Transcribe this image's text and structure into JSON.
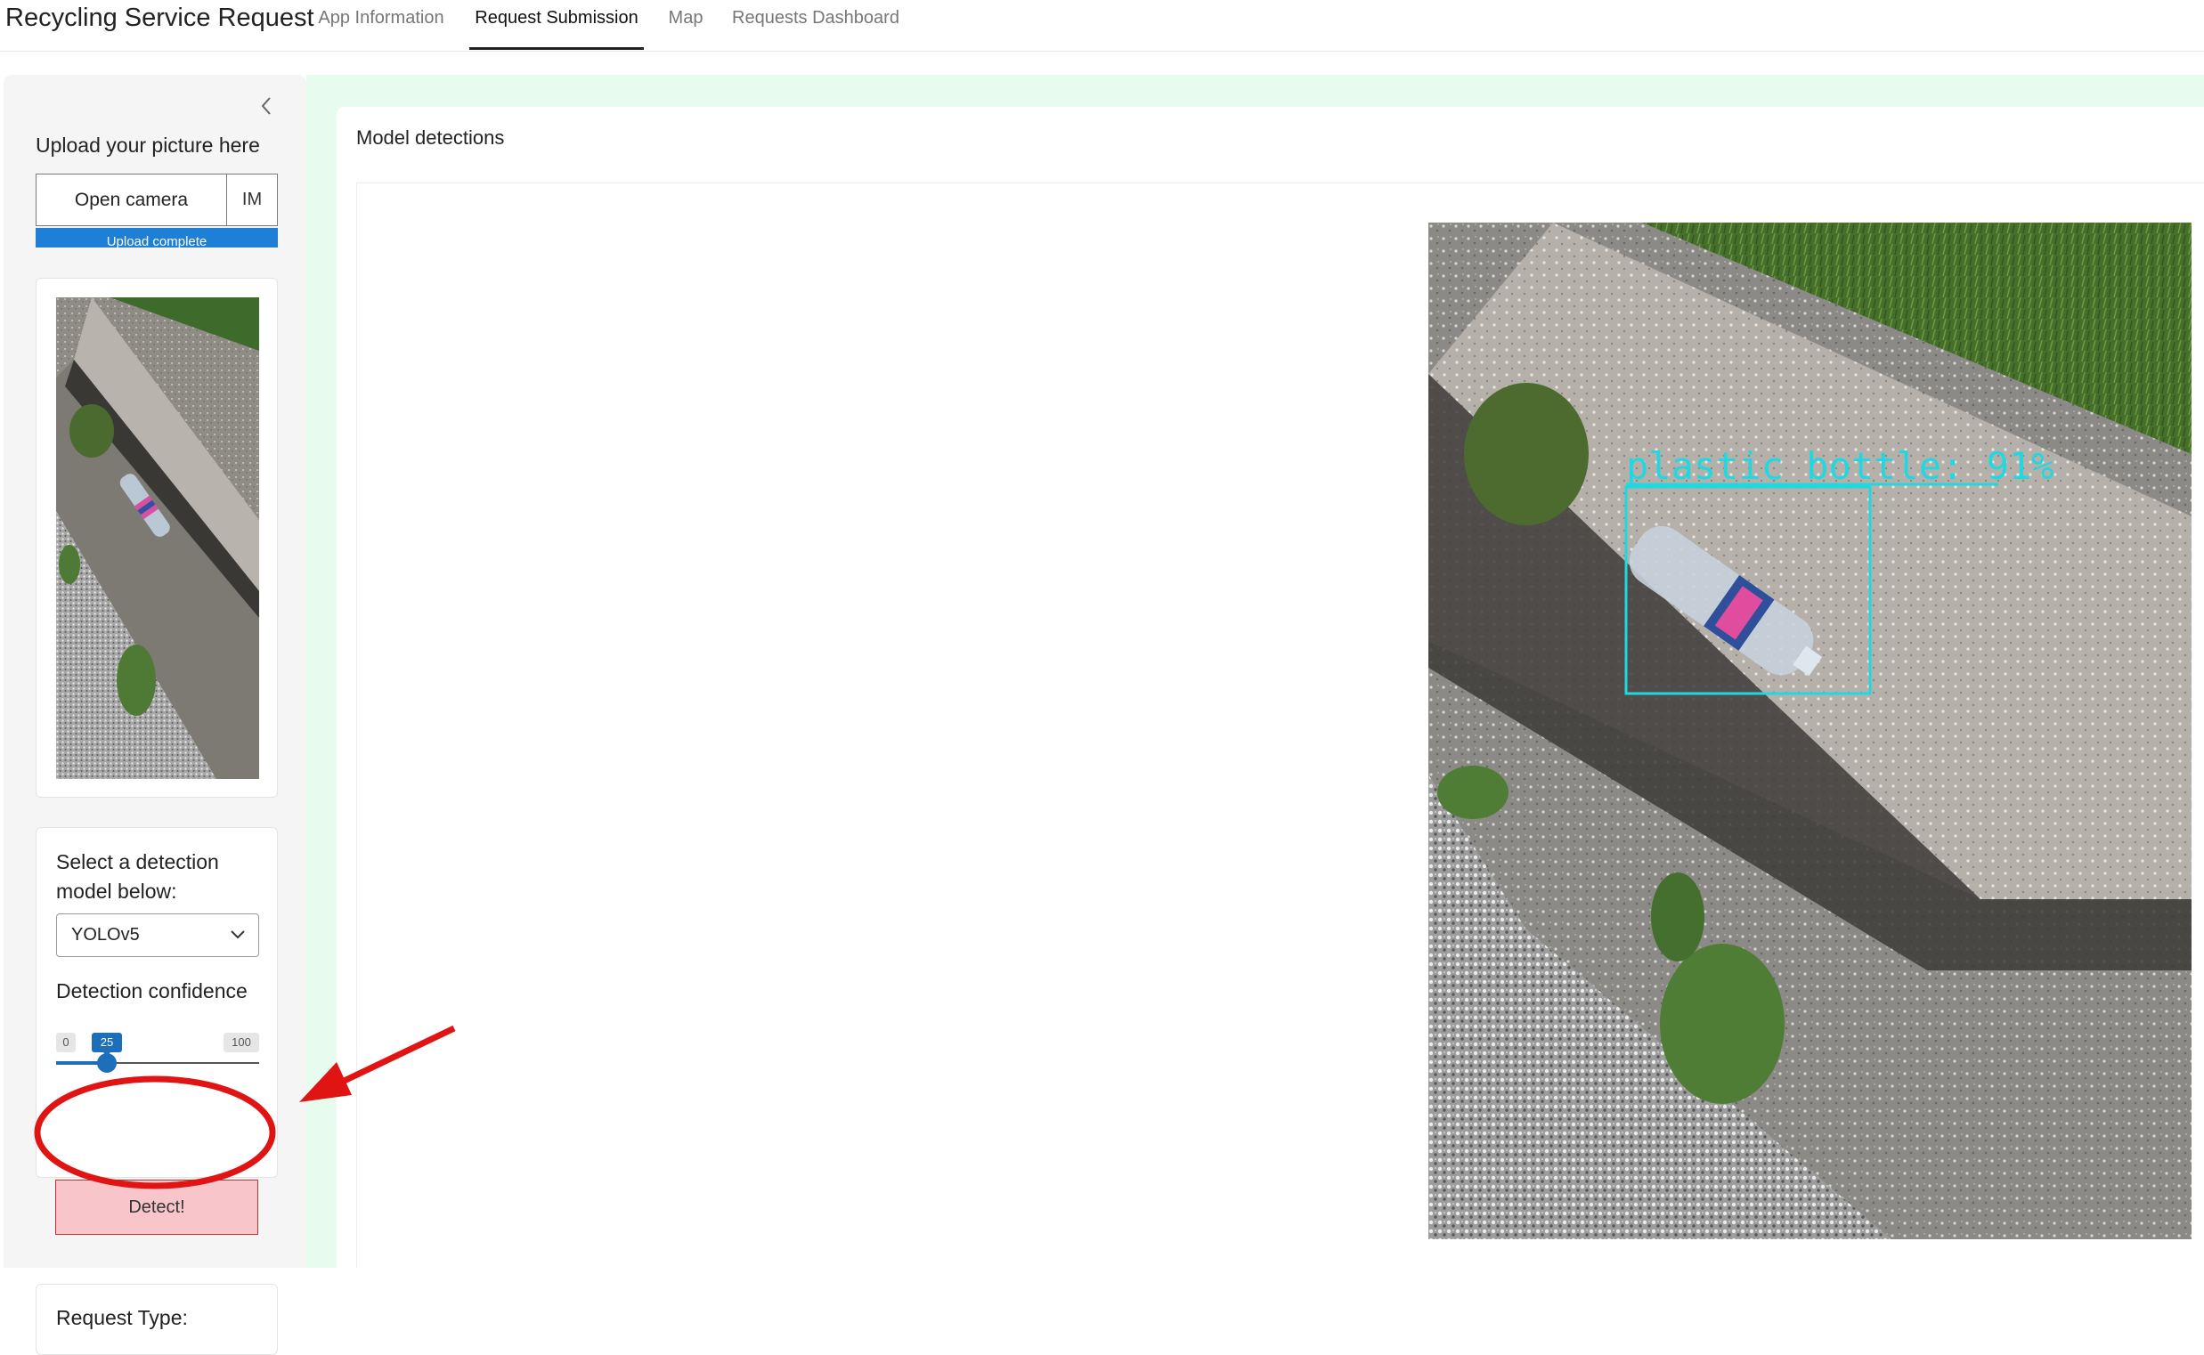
{
  "header": {
    "app_title": "Recycling Service Request",
    "tabs": [
      {
        "label": "App Information",
        "active": false
      },
      {
        "label": "Request Submission",
        "active": true
      },
      {
        "label": "Map",
        "active": false
      },
      {
        "label": "Requests Dashboard",
        "active": false
      }
    ]
  },
  "sidebar": {
    "collapse_icon": "chevron-left-icon",
    "upload_heading": "Upload your picture here",
    "open_camera_label": "Open camera",
    "file_name": "IM",
    "upload_status": "Upload complete",
    "upload_progress": 1.0,
    "model_label": "Select a detection model below:",
    "model_value": "YOLOv5",
    "confidence_label": "Detection confidence",
    "confidence_min": "0",
    "confidence_value": "25",
    "confidence_max": "100",
    "confidence_fraction": 0.25,
    "detect_label": "Detect!",
    "request_type_label": "Request Type:"
  },
  "main": {
    "title": "Model detections",
    "detection_label": "plastic_bottle: 91%"
  },
  "colors": {
    "accent_blue": "#1c6fb8",
    "progress_blue": "#1e7fd6",
    "detect_button_bg": "#f8c6ca",
    "annotation_red": "#e11414",
    "main_bg": "#e7fcef",
    "detection_box": "#22d8e0"
  }
}
